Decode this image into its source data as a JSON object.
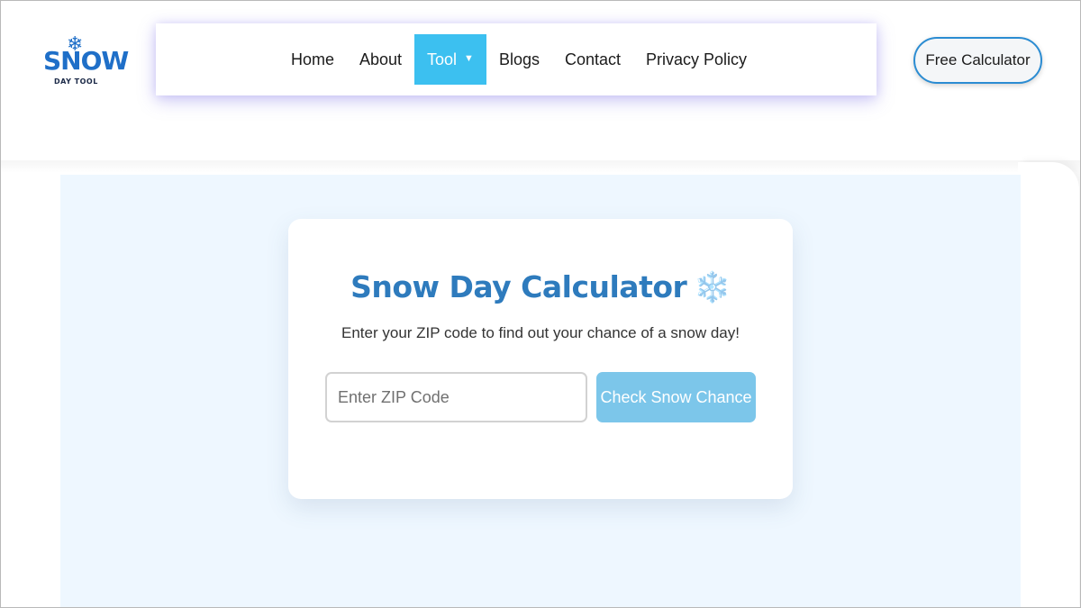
{
  "logo": {
    "word": "SNOW",
    "sub": "DAY TOOL",
    "icon": "snowflake-icon"
  },
  "nav": {
    "items": [
      {
        "label": "Home"
      },
      {
        "label": "About"
      },
      {
        "label": "Tool",
        "active": true,
        "has_dropdown": true
      },
      {
        "label": "Blogs"
      },
      {
        "label": "Contact"
      },
      {
        "label": "Privacy Policy"
      }
    ]
  },
  "header": {
    "cta_label": "Free Calculator"
  },
  "calculator": {
    "title": "Snow Day Calculator",
    "title_icon": "❄️",
    "subtitle": "Enter your ZIP code to find out your chance of a snow day!",
    "zip_placeholder": "Enter ZIP Code",
    "zip_value": "",
    "button_label": "Check Snow Chance"
  },
  "colors": {
    "accent": "#2e7bbd",
    "nav_active": "#3cc0f0",
    "button": "#7cc6ea",
    "hero_bg": "#eef7ff",
    "cta_border": "#2b8cd2"
  }
}
